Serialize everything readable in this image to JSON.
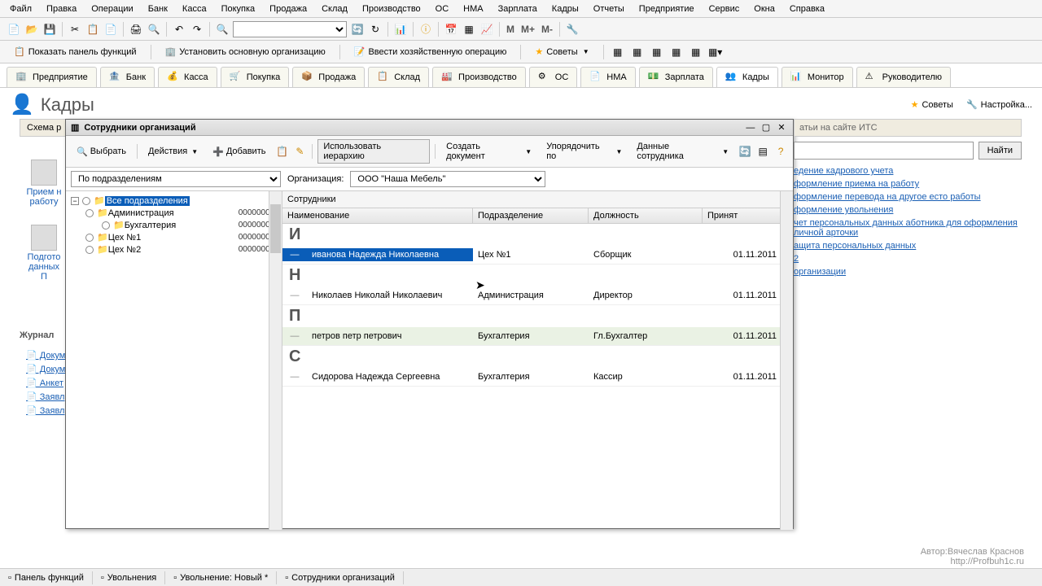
{
  "menu": [
    "Файл",
    "Правка",
    "Операции",
    "Банк",
    "Касса",
    "Покупка",
    "Продажа",
    "Склад",
    "Производство",
    "ОС",
    "НМА",
    "Зарплата",
    "Кадры",
    "Отчеты",
    "Предприятие",
    "Сервис",
    "Окна",
    "Справка"
  ],
  "toolbar2": {
    "show_panel": "Показать панель функций",
    "set_org": "Установить основную организацию",
    "enter_op": "Ввести хозяйственную операцию",
    "tips": "Советы"
  },
  "tabs": [
    {
      "label": "Предприятие",
      "icon": "🏢"
    },
    {
      "label": "Банк",
      "icon": "🏦"
    },
    {
      "label": "Касса",
      "icon": "💰"
    },
    {
      "label": "Покупка",
      "icon": "🛒"
    },
    {
      "label": "Продажа",
      "icon": "📦"
    },
    {
      "label": "Склад",
      "icon": "📋"
    },
    {
      "label": "Производство",
      "icon": "🏭"
    },
    {
      "label": "ОС",
      "icon": "⚙"
    },
    {
      "label": "НМА",
      "icon": "📄"
    },
    {
      "label": "Зарплата",
      "icon": "💵"
    },
    {
      "label": "Кадры",
      "icon": "👥",
      "active": true
    },
    {
      "label": "Монитор",
      "icon": "📊"
    },
    {
      "label": "Руководителю",
      "icon": "⚠"
    }
  ],
  "page": {
    "title": "Кадры",
    "tips_btn": "Советы",
    "settings_btn": "Настройка...",
    "scheme_tab": "Схема р"
  },
  "left_shortcuts": {
    "s1": "Прием н работу",
    "s2": "Подгото данных П",
    "journal": "Журнал",
    "links": [
      "Докум",
      "Докум",
      "Анкет",
      "Заявл",
      "Заявл"
    ]
  },
  "child": {
    "title": "Сотрудники организаций",
    "toolbar": {
      "select": "Выбрать",
      "actions": "Действия",
      "add": "Добавить",
      "use_hierarchy": "Использовать иерархию",
      "create_doc": "Создать документ",
      "sort": "Упорядочить по",
      "emp_data": "Данные сотрудника"
    },
    "filters": {
      "by_dept": "По подразделениям",
      "org_label": "Организация:",
      "org_value": "ООО \"Наша Мебель\""
    },
    "tree": {
      "root": "Все подразделения",
      "items": [
        {
          "label": "Администрация",
          "code": "0000000..."
        },
        {
          "label": "Бухгалтерия",
          "code": "0000000..."
        },
        {
          "label": "Цех №1",
          "code": "0000000..."
        },
        {
          "label": "Цех №2",
          "code": "0000000..."
        }
      ]
    },
    "grid": {
      "title": "Сотрудники",
      "cols": {
        "name": "Наименование",
        "dept": "Подразделение",
        "pos": "Должность",
        "date": "Принят"
      },
      "groups": [
        {
          "letter": "И",
          "rows": [
            {
              "name": "иванова Надежда Николаевна",
              "dept": "Цех №1",
              "pos": "Сборщик",
              "date": "01.11.2011",
              "selected": true
            }
          ]
        },
        {
          "letter": "Н",
          "rows": [
            {
              "name": "Николаев Николай Николаевич",
              "dept": "Администрация",
              "pos": "Директор",
              "date": "01.11.2011"
            }
          ]
        },
        {
          "letter": "П",
          "rows": [
            {
              "name": "петров петр петрович",
              "dept": "Бухгалтерия",
              "pos": "Гл.Бухгалтер",
              "date": "01.11.2011",
              "hover": true
            }
          ]
        },
        {
          "letter": "С",
          "rows": [
            {
              "name": "Сидорова Надежда Сергеевна",
              "dept": "Бухгалтерия",
              "pos": "Кассир",
              "date": "01.11.2011"
            }
          ]
        }
      ]
    }
  },
  "its": {
    "header": "атьи на сайте ИТС",
    "find_btn": "Найти",
    "links": [
      "едение кадрового учета",
      "формление приема на работу",
      "формление перевода на другое есто работы",
      "формление увольнения",
      "чет персональных данных аботника для оформления личной арточки",
      "ащита персональных данных",
      "2",
      "организации"
    ]
  },
  "watermark": {
    "line1": "Автор:Вячеслав Краснов",
    "line2": "http://Profbuh1c.ru"
  },
  "taskbar": [
    "Панель функций",
    "Увольнения",
    "Увольнение: Новый *",
    "Сотрудники организаций"
  ]
}
